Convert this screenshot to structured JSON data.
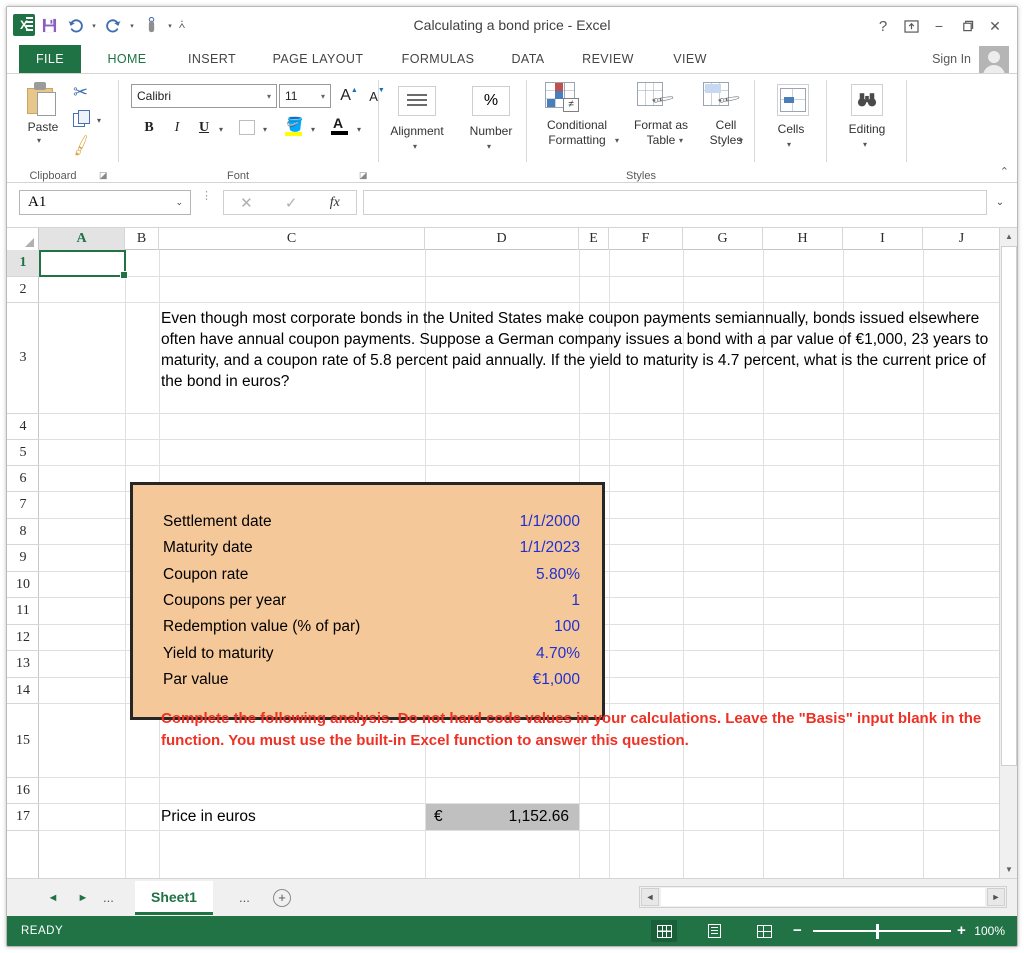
{
  "window": {
    "title": "Calculating a bond price - Excel",
    "help_icon": "?",
    "ribbon_display_icon": "⊼",
    "minimize_icon": "−",
    "restore_icon": "❐",
    "close_icon": "✕",
    "signin": "Sign In",
    "app_logo": "X"
  },
  "quick_access": {
    "save_icon": "save-icon",
    "undo_icon": "↰",
    "redo_icon": "↱",
    "touch_icon": "touch-mode-icon",
    "customize_icon": "⩀"
  },
  "tabs": [
    {
      "label": "FILE"
    },
    {
      "label": "HOME"
    },
    {
      "label": "INSERT"
    },
    {
      "label": "PAGE LAYOUT"
    },
    {
      "label": "FORMULAS"
    },
    {
      "label": "DATA"
    },
    {
      "label": "REVIEW"
    },
    {
      "label": "VIEW"
    }
  ],
  "ribbon": {
    "collapse_icon": "⌃",
    "groups": [
      {
        "label": "Clipboard"
      },
      {
        "label": "Font"
      },
      {
        "label": "Styles"
      }
    ],
    "clipboard": {
      "paste_label": "Paste",
      "cut_icon": "✂",
      "copy_icon": "copy-icon",
      "format_painter_icon": "🖌",
      "dialog_launcher": "⌐"
    },
    "font": {
      "font_name": "Calibri",
      "font_size": "11",
      "grow_font": "A",
      "shrink_font": "A",
      "bold": "B",
      "italic": "I",
      "underline": "U",
      "borders_icon": "borders-icon",
      "fill_color_icon": "fill-color-icon",
      "font_color_icon": "A",
      "dialog_launcher": "⌐"
    },
    "alignment": {
      "label": "Alignment"
    },
    "number": {
      "label": "Number",
      "icon": "%"
    },
    "styles": {
      "conditional_formatting": "Conditional Formatting",
      "format_as_table": "Format as Table",
      "cell_styles": "Cell Styles",
      "neq_glyph": "≠"
    },
    "cells": {
      "label": "Cells"
    },
    "editing": {
      "label": "Editing",
      "icon": "binoculars-icon"
    }
  },
  "formula_bar": {
    "name_box": "A1",
    "name_box_arrow": "⌄",
    "cancel_icon": "✕",
    "enter_icon": "✓",
    "fx_icon": "fx",
    "formula_value": "",
    "expand_icon": "⌄"
  },
  "grid": {
    "columns": [
      "A",
      "B",
      "C",
      "D",
      "E",
      "F",
      "G",
      "H",
      "I",
      "J"
    ],
    "rows": [
      "1",
      "2",
      "3",
      "4",
      "5",
      "6",
      "7",
      "8",
      "9",
      "10",
      "11",
      "12",
      "13",
      "14",
      "15",
      "16",
      "17"
    ],
    "selected_cell": "A1",
    "question_text": "Even though most corporate bonds in the United States make coupon payments semiannually, bonds issued elsewhere often have annual coupon payments. Suppose a German company issues a bond with a par value of €1,000, 23 years to maturity, and a coupon rate of 5.8 percent paid annually. If the yield to maturity is 4.7 percent, what is the current price of the bond in euros?",
    "instruction_text": "Complete the following analysis. Do not hard code values in your calculations. Leave the \"Basis\" input blank in the function. You must use the built-in Excel function to answer this question.",
    "input_box": {
      "fill_color": "#f5c89a",
      "border_color": "#262626",
      "value_color": "#2030d0",
      "rows": [
        {
          "label": "Settlement date",
          "value": "1/1/2000"
        },
        {
          "label": "Maturity date",
          "value": "1/1/2023"
        },
        {
          "label": "Coupon rate",
          "value": "5.80%"
        },
        {
          "label": "Coupons per year",
          "value": "1"
        },
        {
          "label": "Redemption value (% of par)",
          "value": "100"
        },
        {
          "label": "Yield to maturity",
          "value": "4.70%"
        },
        {
          "label": "Par value",
          "value": "€1,000"
        }
      ]
    },
    "output": {
      "label": "Price in euros",
      "currency": "€",
      "amount": "1,152.66",
      "cell_fill": "#c0c0c0"
    }
  },
  "sheet_bar": {
    "first_icon": "◄",
    "prev_icon": "►",
    "left_ellipsis": "...",
    "sheet_name": "Sheet1",
    "right_ellipsis": "...",
    "add_sheet_icon": "+",
    "hscroll_left": "◄",
    "hscroll_right": "►"
  },
  "status_bar": {
    "status": "READY",
    "view_normal_icon": "normal-view-icon",
    "view_layout_icon": "page-layout-view-icon",
    "view_break_icon": "page-break-view-icon",
    "zoom_out": "−",
    "zoom_in": "+",
    "zoom_level": "100%"
  },
  "theme": {
    "excel_green": "#217346",
    "accent_red": "#ee3124",
    "value_blue": "#2030d0",
    "box_orange": "#f5c89a"
  }
}
